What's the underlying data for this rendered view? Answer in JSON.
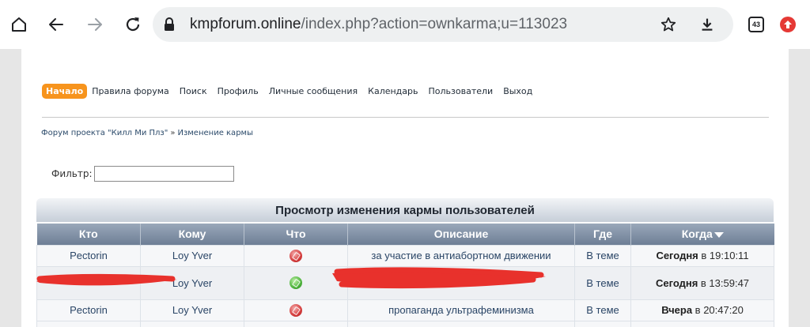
{
  "browser": {
    "url_host": "kmpforum.online",
    "url_path": "/index.php?action=ownkarma;u=113023",
    "tab_count": "43",
    "icons": [
      "home-icon",
      "back-arrow-icon",
      "forward-arrow-icon",
      "reload-icon",
      "lock-icon",
      "star-icon",
      "download-icon",
      "tabs-icon",
      "extension-icon"
    ]
  },
  "nav": {
    "active": "Начало",
    "items": [
      "Правила форума",
      "Поиск",
      "Профиль",
      "Личные сообщения",
      "Календарь",
      "Пользователи",
      "Выход"
    ]
  },
  "breadcrumb": {
    "forum": "Форум проекта \"Килл Ми Плз\"",
    "separator": "»",
    "current": "Изменение кармы"
  },
  "filter": {
    "label": "Фильтр:",
    "value": ""
  },
  "karma_table": {
    "title": "Просмотр изменения кармы пользователей",
    "columns": [
      "Кто",
      "Кому",
      "Что",
      "Описание",
      "Где",
      "Когда"
    ],
    "rows": [
      {
        "who": "Pectorin",
        "to": "Loy Yver",
        "what": "minus",
        "description": "за участие в антиабортном движении",
        "where": "В теме",
        "when_day": "Сегодня",
        "when_time": "в 19:10:11"
      },
      {
        "who": "",
        "to": "Loy Yver",
        "what": "plus",
        "description": "",
        "where": "В теме",
        "when_day": "Сегодня",
        "when_time": "в 13:59:47"
      },
      {
        "who": "Pectorin",
        "to": "Loy Yver",
        "what": "minus",
        "description": "пропаганда ультрафеминизма",
        "where": "В теме",
        "when_day": "Вчера",
        "when_time": "в 20:47:20"
      }
    ]
  },
  "colors": {
    "accent": "#f7941d",
    "header_bar": "#7b8ba1",
    "link": "#2a4566",
    "redaction": "#e8312c"
  }
}
